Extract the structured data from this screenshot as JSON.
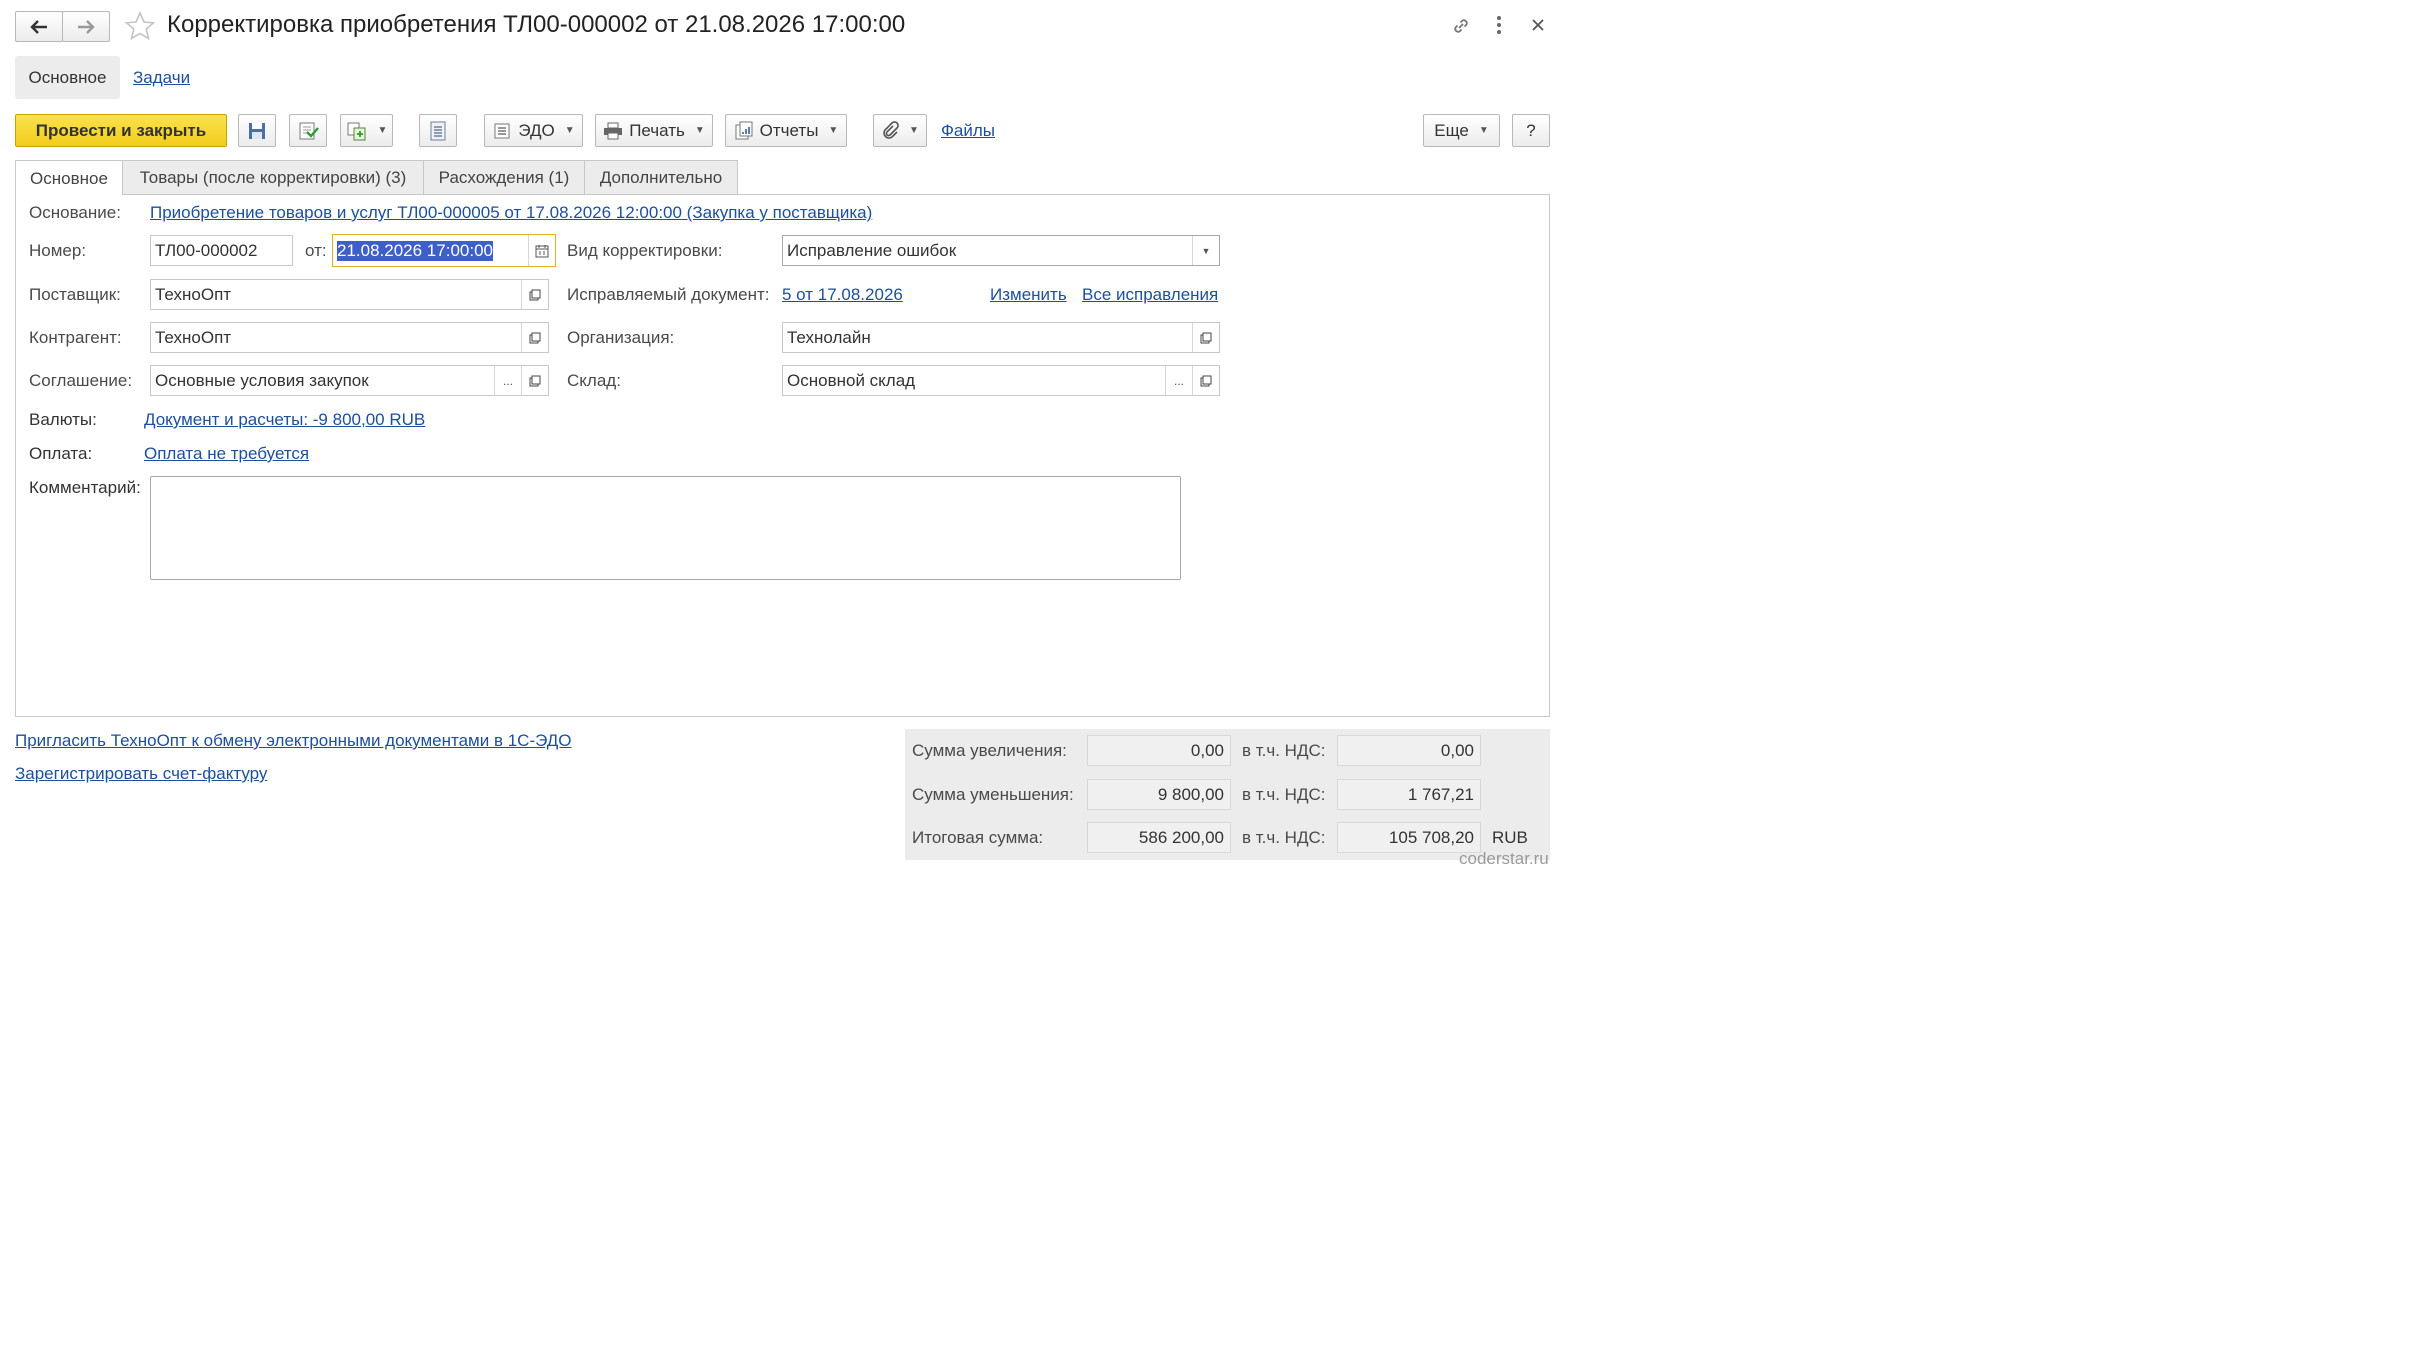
{
  "window": {
    "title": "Корректировка приобретения ТЛ00-000002 от 21.08.2026 17:00:00"
  },
  "section_tabs": {
    "main": "Основное",
    "tasks": "Задачи"
  },
  "toolbar": {
    "post_close": "Провести и закрыть",
    "edo": "ЭДО",
    "print": "Печать",
    "reports": "Отчеты",
    "files": "Файлы",
    "more": "Еще",
    "help": "?"
  },
  "tabs": [
    {
      "label": "Основное"
    },
    {
      "label": "Товары (после корректировки) (3)"
    },
    {
      "label": "Расхождения (1)"
    },
    {
      "label": "Дополнительно"
    }
  ],
  "form": {
    "basis_label": "Основание:",
    "basis_link": "Приобретение товаров и услуг ТЛ00-000005 от 17.08.2026 12:00:00 (Закупка у поставщика)",
    "number_label": "Номер:",
    "number": "ТЛ00-000002",
    "from_label": "от:",
    "date": "21.08.2026 17:00:00",
    "supplier_label": "Поставщик:",
    "supplier": "ТехноОпт",
    "counterparty_label": "Контрагент:",
    "counterparty": "ТехноОпт",
    "agreement_label": "Соглашение:",
    "agreement": "Основные условия закупок",
    "correction_type_label": "Вид корректировки:",
    "correction_type": "Исправление ошибок",
    "corrected_doc_label": "Исправляемый документ:",
    "corrected_doc_link": "5 от 17.08.2026",
    "change_link": "Изменить",
    "all_corrections_link": "Все исправления",
    "organization_label": "Организация:",
    "organization": "Технолайн",
    "warehouse_label": "Склад:",
    "warehouse": "Основной склад",
    "currency_label": "Валюты:",
    "currency_link": "Документ и расчеты: -9 800,00 RUB",
    "payment_label": "Оплата:",
    "payment_link": "Оплата не требуется",
    "comment_label": "Комментарий:",
    "comment": "",
    "ellipsis": "..."
  },
  "footer": {
    "invite_link": "Пригласить ТехноОпт к обмену электронными документами в 1С-ЭДО",
    "register_invoice_link": "Зарегистрировать счет-фактуру"
  },
  "totals": {
    "increase_label": "Сумма увеличения:",
    "increase": "0,00",
    "increase_vat": "0,00",
    "decrease_label": "Сумма уменьшения:",
    "decrease": "9 800,00",
    "decrease_vat": "1 767,21",
    "total_label": "Итоговая сумма:",
    "total": "586 200,00",
    "total_vat": "105 708,20",
    "vat_label": "в т.ч. НДС:",
    "currency": "RUB"
  },
  "watermark": "coderstar.ru",
  "colors": {
    "accent_button": "#f6d631",
    "link": "#1c4f9c",
    "selection": "#3d5fc7"
  }
}
